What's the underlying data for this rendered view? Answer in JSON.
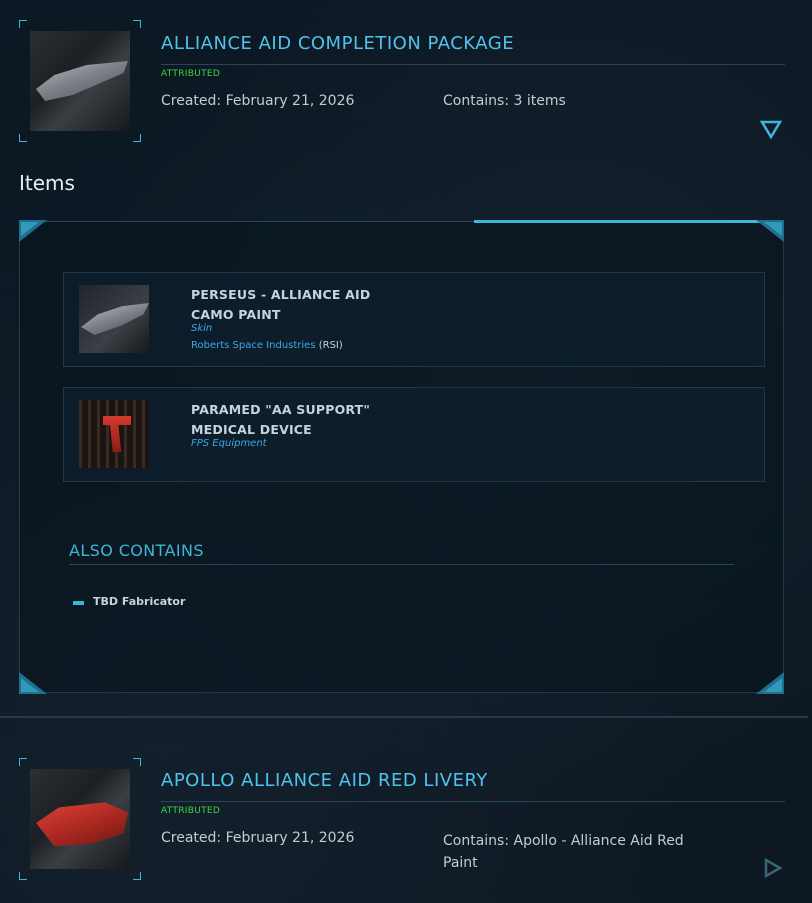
{
  "package1": {
    "title": "ALLIANCE AID COMPLETION PACKAGE",
    "badge": "ATTRIBUTED",
    "created": "Created: February 21, 2026",
    "contains": "Contains: 3 items",
    "thumbnail": "ship-render"
  },
  "items_section": {
    "heading": "Items",
    "items": [
      {
        "name_line1": "PERSEUS - ALLIANCE AID",
        "name_line2": "CAMO PAINT",
        "type": "Skin",
        "manufacturer": "Roberts Space Industries",
        "manufacturer_code": "(RSI)",
        "thumbnail": "ship-render"
      },
      {
        "name_line1": "PARAMED \"AA SUPPORT\"",
        "name_line2": "MEDICAL DEVICE",
        "type": "FPS Equipment",
        "thumbnail": "medical-device-render"
      }
    ],
    "also_contains": {
      "heading": "ALSO CONTAINS",
      "items": [
        "TBD Fabricator"
      ]
    }
  },
  "package2": {
    "title": "APOLLO ALLIANCE AID RED LIVERY",
    "badge": "ATTRIBUTED",
    "created": "Created: February 21, 2026",
    "contains_line1": "Contains: Apollo - Alliance Aid Red",
    "contains_line2": "Paint",
    "thumbnail": "red-ship-render"
  },
  "colors": {
    "accent": "#3fb6d8",
    "title": "#4fc3ec",
    "badge": "#3bd83b",
    "link": "#3da8e8"
  },
  "icons": {
    "expand": "triangle-down-icon",
    "collapse": "triangle-right-icon"
  }
}
